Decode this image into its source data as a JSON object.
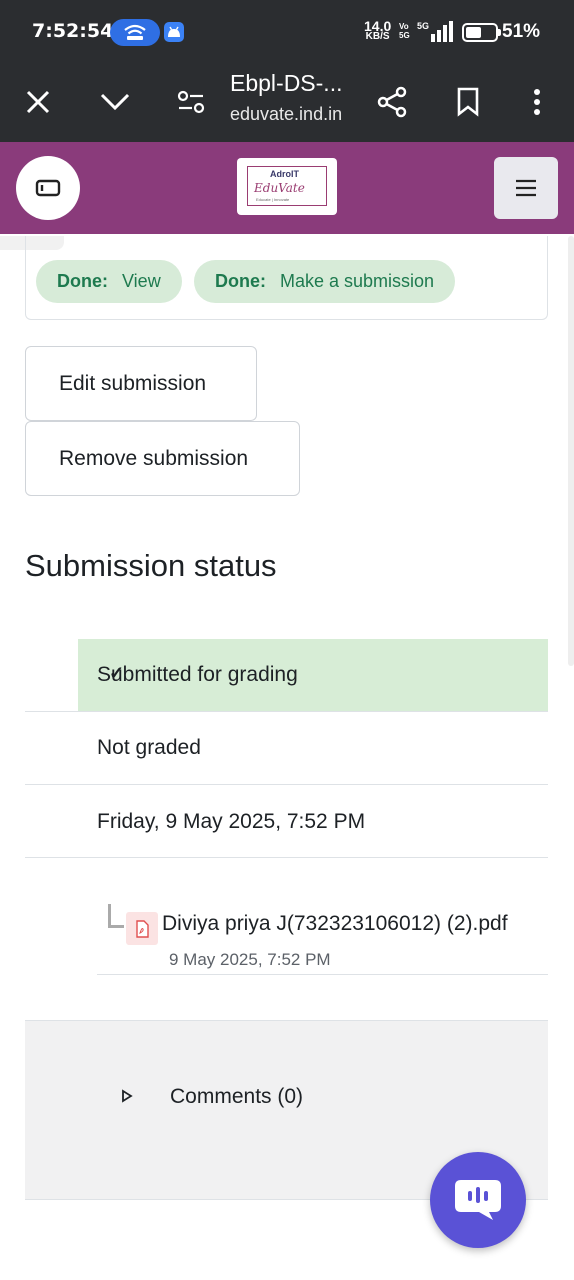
{
  "status_bar": {
    "time": "7:52:54",
    "speed_value": "14.0",
    "speed_unit": "KB/S",
    "network": "5G",
    "battery": "51%"
  },
  "browser": {
    "title": "Ebpl-DS-...",
    "domain": "eduvate.ind.in",
    "icons": [
      "close-icon",
      "chevron-down-icon",
      "site-settings-icon",
      "share-icon",
      "bookmark-icon",
      "more-vert-icon"
    ]
  },
  "site": {
    "logo_top": "AdroIT",
    "logo_main": "EduVate",
    "logo_sub": "Educate | Innovate"
  },
  "completion": [
    {
      "key": "Done:",
      "value": "View"
    },
    {
      "key": "Done:",
      "value": "Make a submission"
    }
  ],
  "actions": {
    "edit": "Edit submission",
    "remove": "Remove submission"
  },
  "submission": {
    "heading": "Submission status",
    "status": "Submitted for grading",
    "grading": "Not graded",
    "modified": "Friday, 9 May 2025, 7:52 PM",
    "file_name": "Diviya priya J(732323106012) (2).pdf",
    "file_date": "9 May 2025, 7:52 PM",
    "comments": "Comments (0)"
  },
  "colors": {
    "header": "#8a3b7b",
    "status_bg": "#d7edd6",
    "pill_bg": "#d7ebd8",
    "pill_text": "#1e7a4f",
    "chat_fab": "#5a52d6"
  }
}
